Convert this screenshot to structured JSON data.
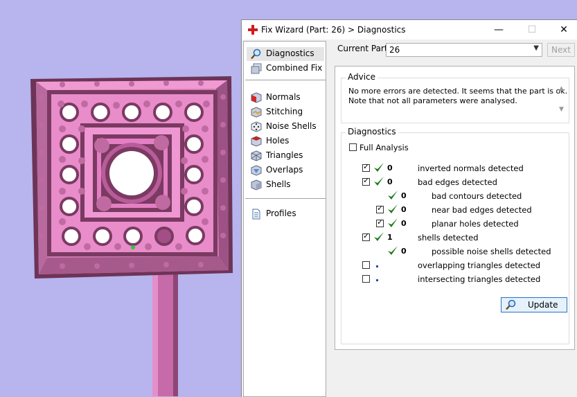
{
  "window": {
    "title": "Fix Wizard (Part: 26) > Diagnostics",
    "minimize": "—",
    "maximize": "☐",
    "close": "✕"
  },
  "nav": {
    "items": [
      {
        "label": "Diagnostics",
        "icon": "magnifier-icon",
        "selected": true
      },
      {
        "label": "Combined Fix",
        "icon": "stack-icon"
      },
      {
        "label": "Normals",
        "icon": "cube-normals-icon"
      },
      {
        "label": "Stitching",
        "icon": "stitching-icon"
      },
      {
        "label": "Noise Shells",
        "icon": "dice-icon"
      },
      {
        "label": "Holes",
        "icon": "hole-cube-icon"
      },
      {
        "label": "Triangles",
        "icon": "triangle-cube-icon"
      },
      {
        "label": "Overlaps",
        "icon": "overlap-cube-icon"
      },
      {
        "label": "Shells",
        "icon": "shell-cube-icon"
      },
      {
        "label": "Profiles",
        "icon": "document-icon"
      }
    ]
  },
  "current_part": {
    "label": "Current Part:",
    "value": "26",
    "next": "Next"
  },
  "advice": {
    "title": "Advice",
    "line1": "No more errors are detected. It seems that the part is ok.",
    "line2": "Note that not all parameters were analysed."
  },
  "diagnostics": {
    "title": "Diagnostics",
    "full_analysis": "Full Analysis",
    "rows": [
      {
        "checked": true,
        "status": "ok",
        "count": "0",
        "label": "inverted normals detected"
      },
      {
        "checked": true,
        "status": "ok",
        "count": "0",
        "label": "bad edges detected"
      },
      {
        "checked": null,
        "status": "ok",
        "count": "0",
        "label": "bad contours detected"
      },
      {
        "checked": true,
        "status": "ok",
        "count": "0",
        "label": "near bad edges detected"
      },
      {
        "checked": true,
        "status": "ok",
        "count": "0",
        "label": "planar holes detected"
      },
      {
        "checked": true,
        "status": "ok",
        "count": "1",
        "label": "shells detected"
      },
      {
        "checked": null,
        "status": "ok",
        "count": "0",
        "label": "possible noise shells detected"
      },
      {
        "checked": false,
        "status": "dot",
        "count": "",
        "label": "overlapping triangles detected"
      },
      {
        "checked": false,
        "status": "dot",
        "count": "",
        "label": "intersecting triangles detected"
      }
    ],
    "update": "Update"
  },
  "colors": {
    "viewport_bg": "#b7b4ee",
    "model_pink": "#e685c8",
    "model_dark": "#7a3a62",
    "ok_green": "#1c7a1c"
  }
}
